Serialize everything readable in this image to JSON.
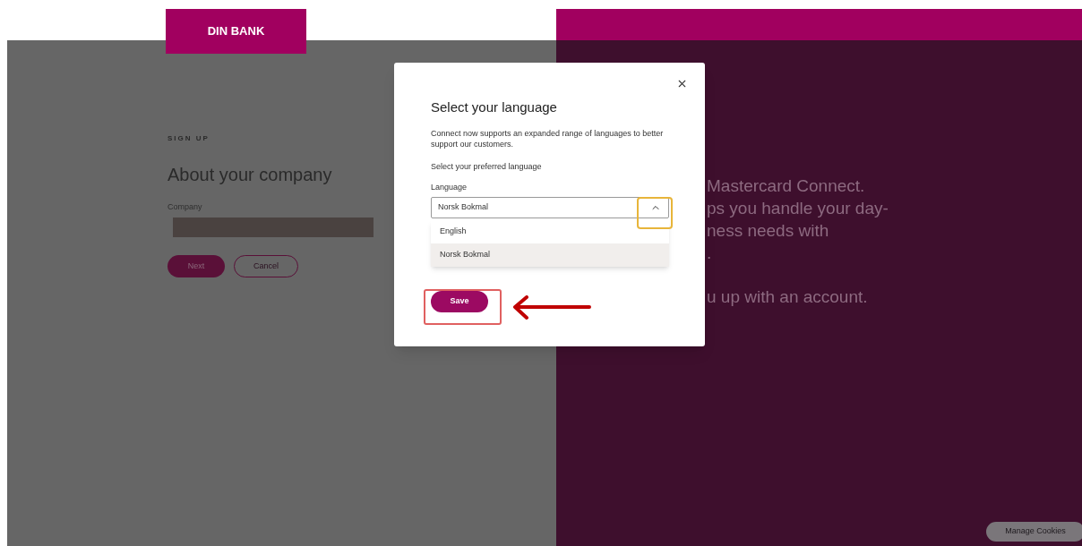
{
  "logo": {
    "text": "DIN BANK"
  },
  "form": {
    "eyebrow": "SIGN UP",
    "heading": "About your company",
    "company_label": "Company",
    "buttons": [
      {
        "label": "Next",
        "kind": "primary"
      },
      {
        "label": "Cancel",
        "kind": "secondary"
      }
    ]
  },
  "right_panel": {
    "lines": [
      "Mastercard Connect.",
      "ps you handle your day-",
      "ness needs with",
      ".",
      "u up with an account."
    ]
  },
  "dialog": {
    "title": "Select your language",
    "description": "Connect now supports an expanded range of languages to better support our customers.",
    "prompt": "Select your preferred language",
    "field_label": "Language",
    "value": "Norsk Bokmal",
    "expanded": true,
    "options": [
      {
        "label": "English",
        "selected": false
      },
      {
        "label": "Norsk Bokmal",
        "selected": true
      }
    ],
    "save": "Save"
  },
  "cookies_button": "Manage Cookies"
}
